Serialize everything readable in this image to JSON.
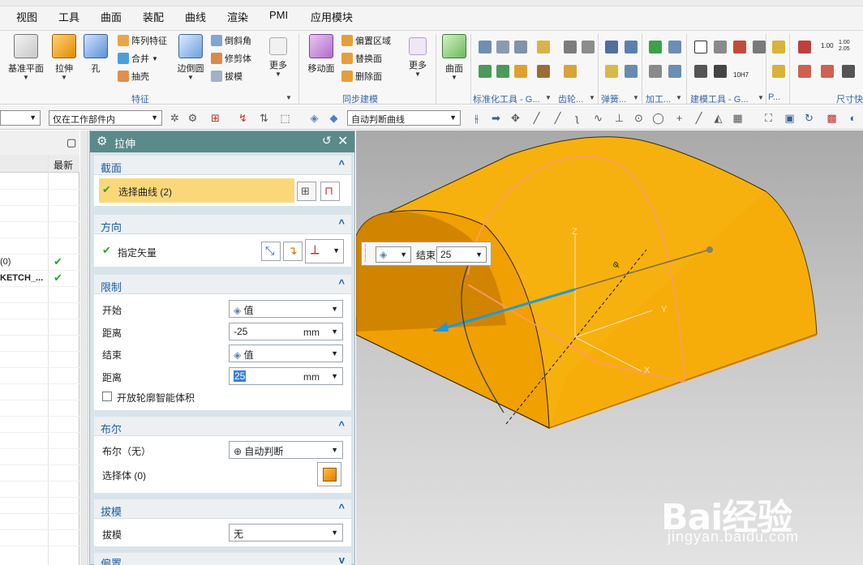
{
  "menu": {
    "items": [
      "视图",
      "工具",
      "曲面",
      "装配",
      "曲线",
      "渲染",
      "PMI",
      "应用模块"
    ]
  },
  "ribbon": {
    "datum_plane": "基准平面",
    "extrude": "拉伸",
    "hole": "孔",
    "pattern_feature": "阵列特征",
    "unite": "合并",
    "shell": "抽壳",
    "edge_blend": "边倒圆",
    "chamfer": "倒斜角",
    "trim_body": "修剪体",
    "draft": "拔模",
    "more1": "更多",
    "move_face": "移动面",
    "offset_region": "偏置区域",
    "replace_face": "替换面",
    "delete_face": "删除面",
    "more2": "更多",
    "surface": "曲面",
    "group_feature": "特征",
    "group_sync": "同步建模",
    "group_std_tools": "标准化工具 - G...",
    "group_gear": "齿轮...",
    "group_spring": "弹簧...",
    "group_machining": "加工...",
    "group_building": "建模工具 - G...",
    "group_p": "P...",
    "group_dim": "尺寸快",
    "dim_100": "1.00",
    "dim_100_005": "1.00\n2.05",
    "label_10h7": "10H7"
  },
  "filterbar": {
    "type_filter": "",
    "scope_filter": "仅在工作部件内",
    "curve_rule": "自动判断曲线"
  },
  "navigator": {
    "column_latest": "最新",
    "row1_text": "(0)",
    "row2_text": "KETCH_..."
  },
  "dialog": {
    "title": "拉伸",
    "section": {
      "title": "截面",
      "select_curve": "选择曲线 (2)"
    },
    "direction": {
      "title": "方向",
      "specify_vector": "指定矢量"
    },
    "limits": {
      "title": "限制",
      "start_label": "开始",
      "start_value": "值",
      "distance1_label": "距离",
      "distance1_value": "-25",
      "distance1_unit": "mm",
      "end_label": "结束",
      "end_value": "值",
      "distance2_label": "距离",
      "distance2_value": "25",
      "distance2_unit": "mm",
      "open_profile": "开放轮廓智能体积"
    },
    "boolean": {
      "title": "布尔",
      "bool_label": "布尔（无）",
      "bool_value": "自动判断",
      "select_body": "选择体 (0)"
    },
    "draft": {
      "title": "拔模",
      "draft_label": "拔模",
      "draft_value": "无"
    },
    "offset": {
      "title": "偏置"
    }
  },
  "onscreen_input": {
    "label": "结束",
    "value": "25"
  },
  "viewport": {
    "axis_x": "X",
    "axis_y": "Y",
    "axis_z": "Z",
    "dim_label": "φ"
  },
  "watermark": {
    "brand": "Bai经验",
    "url": "jingyan.baidu.com"
  },
  "colors": {
    "body_front": "#f5a300",
    "body_top": "#f8b414",
    "dialog_title": "#5a8a8a",
    "section_title": "#1f5e9e",
    "highlight_row": "#fad87a"
  }
}
